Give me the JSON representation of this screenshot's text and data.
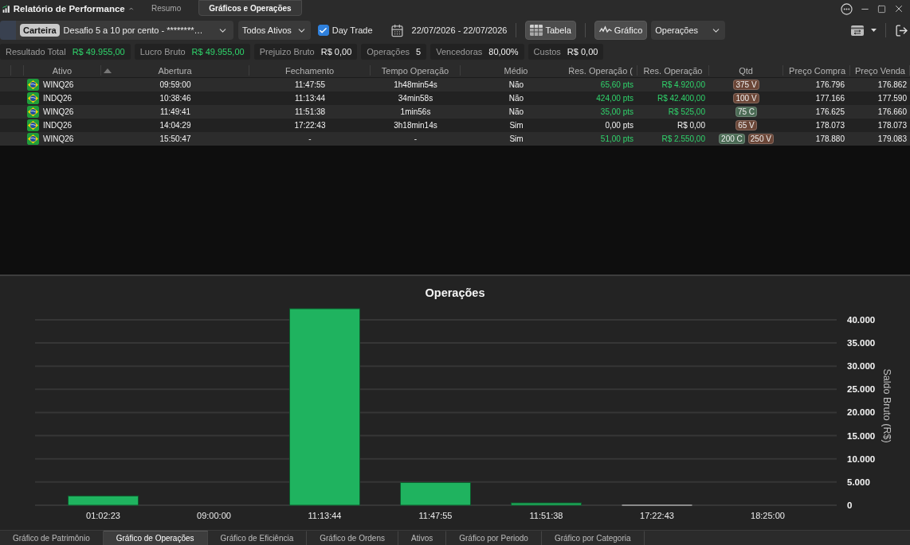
{
  "window": {
    "title": "Relatório de Performance",
    "tabs": [
      {
        "label": "Resumo",
        "selected": false
      },
      {
        "label": "Gráficos e Operações",
        "selected": true
      }
    ]
  },
  "toolbar": {
    "portfolio": {
      "tag": "Carteira",
      "value": "Desafio 5 a 10 por cento - ********…"
    },
    "asset_filter": "Todos Ativos",
    "day_trade": {
      "label": "Day Trade",
      "checked": true
    },
    "date_range": "22/07/2026 - 22/07/2026",
    "view_toggles": [
      {
        "kind": "table",
        "label": "Tabela",
        "selected": true
      },
      {
        "kind": "chart",
        "label": "Gráfico",
        "selected": true
      }
    ],
    "chart_select": "Operações"
  },
  "summary": [
    {
      "label": "Resultado Total",
      "value": "R$ 49.955,00",
      "positive": true
    },
    {
      "label": "Lucro Bruto",
      "value": "R$ 49.955,00",
      "positive": true
    },
    {
      "label": "Prejuizo Bruto",
      "value": "R$ 0,00",
      "positive": false
    },
    {
      "label": "Operações",
      "value": "5",
      "positive": false
    },
    {
      "label": "Vencedoras",
      "value": "80,00%",
      "positive": false
    },
    {
      "label": "Custos",
      "value": "R$ 0,00",
      "positive": false
    }
  ],
  "table": {
    "columns": [
      {
        "label": "Ativo",
        "sorted": false
      },
      {
        "label": "Abertura",
        "sorted": true
      },
      {
        "label": "Fechamento",
        "sorted": false
      },
      {
        "label": "Tempo Operação",
        "sorted": false
      },
      {
        "label": "Médio",
        "sorted": false
      },
      {
        "label": "Res. Operação (",
        "sorted": false
      },
      {
        "label": "Res. Operação",
        "sorted": false
      },
      {
        "label": "Qtd",
        "sorted": false
      },
      {
        "label": "Preço Compra",
        "sorted": false
      },
      {
        "label": "Preço Venda",
        "sorted": false
      }
    ],
    "rows": [
      {
        "asset": "WINQ26",
        "opened": "09:59:00",
        "closed": "11:47:55",
        "duration": "1h48min54s",
        "average": "Não",
        "result_points": "65,60 pts",
        "result_value": "R$ 4.920,00",
        "positive": true,
        "quantity": [
          {
            "text": "375 V",
            "color": "#6b4637"
          }
        ],
        "buy_price": "176.796",
        "sell_price": "176.862"
      },
      {
        "asset": "INDQ26",
        "opened": "10:38:46",
        "closed": "11:13:44",
        "duration": "34min58s",
        "average": "Não",
        "result_points": "424,00 pts",
        "result_value": "R$ 42.400,00",
        "positive": true,
        "quantity": [
          {
            "text": "100 V",
            "color": "#6b4637"
          }
        ],
        "buy_price": "177.166",
        "sell_price": "177.590"
      },
      {
        "asset": "WINQ26",
        "opened": "11:49:41",
        "closed": "11:51:38",
        "duration": "1min56s",
        "average": "Não",
        "result_points": "35,00 pts",
        "result_value": "R$ 525,00",
        "positive": true,
        "quantity": [
          {
            "text": "75 C",
            "color": "#4b6b55"
          }
        ],
        "buy_price": "176.625",
        "sell_price": "176.660"
      },
      {
        "asset": "INDQ26",
        "opened": "14:04:29",
        "closed": "17:22:43",
        "duration": "3h18min14s",
        "average": "Sim",
        "result_points": "0,00 pts",
        "result_value": "R$ 0,00",
        "positive": false,
        "quantity": [
          {
            "text": "65 V",
            "color": "#6b4637"
          }
        ],
        "buy_price": "178.073",
        "sell_price": "178.073"
      },
      {
        "asset": "WINQ26",
        "opened": "15:50:47",
        "closed": "-",
        "duration": "-",
        "average": "Sim",
        "result_points": "51,00 pts",
        "result_value": "R$ 2.550,00",
        "positive": true,
        "quantity": [
          {
            "text": "200 C",
            "color": "#4b6b55"
          },
          {
            "text": "250 V",
            "color": "#6b4637"
          }
        ],
        "buy_price": "178.880",
        "sell_price": "179.083"
      }
    ]
  },
  "chart": {
    "chart_data": {
      "type": "bar",
      "title": "Operações",
      "ylabel": "Saldo Bruto (R$)",
      "categories": [
        "01:02:23",
        "09:00:00",
        "11:13:44",
        "11:47:55",
        "11:51:38",
        "17:22:43",
        "18:25:00"
      ],
      "values": [
        2000,
        null,
        42400,
        4900,
        500,
        0,
        null
      ],
      "grid": true,
      "ylim": [
        0,
        42400
      ],
      "yticks": [
        {
          "value": 0,
          "label": "0"
        },
        {
          "value": 5000,
          "label": "5.000"
        },
        {
          "value": 10000,
          "label": "10.000"
        },
        {
          "value": 15000,
          "label": "15.000"
        },
        {
          "value": 20000,
          "label": "20.000"
        },
        {
          "value": 25000,
          "label": "25.000"
        },
        {
          "value": 30000,
          "label": "30.000"
        },
        {
          "value": 35000,
          "label": "35.000"
        },
        {
          "value": 40000,
          "label": "40.000"
        }
      ]
    }
  },
  "bottom_tabs": [
    {
      "label": "Gráfico de Patrimônio",
      "selected": false
    },
    {
      "label": "Gráfico de Operações",
      "selected": true
    },
    {
      "label": "Gráfico de Eficiência",
      "selected": false
    },
    {
      "label": "Gráfico de Ordens",
      "selected": false
    },
    {
      "label": "Ativos",
      "selected": false
    },
    {
      "label": "Gráfico por Periodo",
      "selected": false
    },
    {
      "label": "Gráfico por Categoria",
      "selected": false
    }
  ]
}
